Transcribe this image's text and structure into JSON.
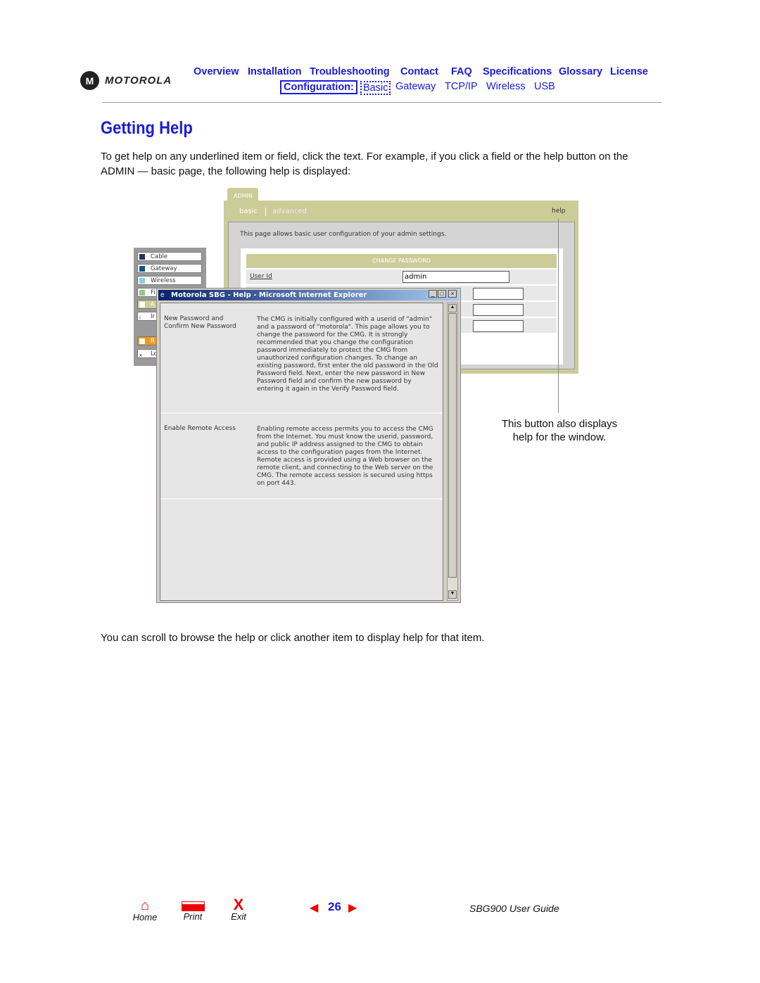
{
  "brand": "MOTOROLA",
  "nav": {
    "top": [
      "Overview",
      "Installation",
      "Troubleshooting",
      "Contact",
      "FAQ",
      "Specifications",
      "Glossary",
      "License"
    ],
    "config_label": "Configuration:",
    "config": [
      "Basic",
      "Gateway",
      "TCP/IP",
      "Wireless",
      "USB"
    ]
  },
  "page_title": "Getting Help",
  "intro": "To get help on any underlined item or field, click the text. For example, if you click a field or the help button on the ADMIN — basic page, the following help is displayed:",
  "screenshot": {
    "admin_tab": "ADMIN",
    "subtabs": [
      "basic",
      "advanced"
    ],
    "help": "help",
    "desc": "This page allows basic user configuration of your admin settings.",
    "section": "CHANGE PASSWORD",
    "user_id_label": "User Id",
    "user_id_value": "admin",
    "sidebar": [
      "Cable",
      "Gateway",
      "Wireless",
      "Fi",
      "A",
      "Ir",
      "R",
      "Lo"
    ],
    "popup_title": "Motorola SBG - Help - Microsoft Internet Explorer",
    "help_items": [
      {
        "term": "New Password and Confirm New Password",
        "text": "The CMG is initially configured with a userid of \"admin\" and a password of \"motorola\". This page allows you to change the password for the CMG. It is strongly recommended that you change the configuration password immediately to protect the CMG from unauthorized configuration changes. To change an existing password, first enter the old password in the Old Password field. Next, enter the new password in New Password field and confirm the new password by entering it again in the Verify Password field."
      },
      {
        "term": "Enable Remote Access",
        "text": "Enabling remote access permits you to access the CMG from the Internet. You must know the userid, password, and public IP address assigned to the CMG to obtain access to the configuration pages from the Internet. Remote access is provided using a Web browser on the remote client, and connecting to the Web server on the CMG. The remote access session is secured using https on port 443."
      }
    ]
  },
  "callout": "This button also displays help for the window.",
  "outro": "You can scroll to browse the help or click another item to display help for that item.",
  "footer": {
    "home": "Home",
    "print": "Print",
    "exit": "Exit",
    "page": "26",
    "guide": "SBG900 User Guide"
  }
}
